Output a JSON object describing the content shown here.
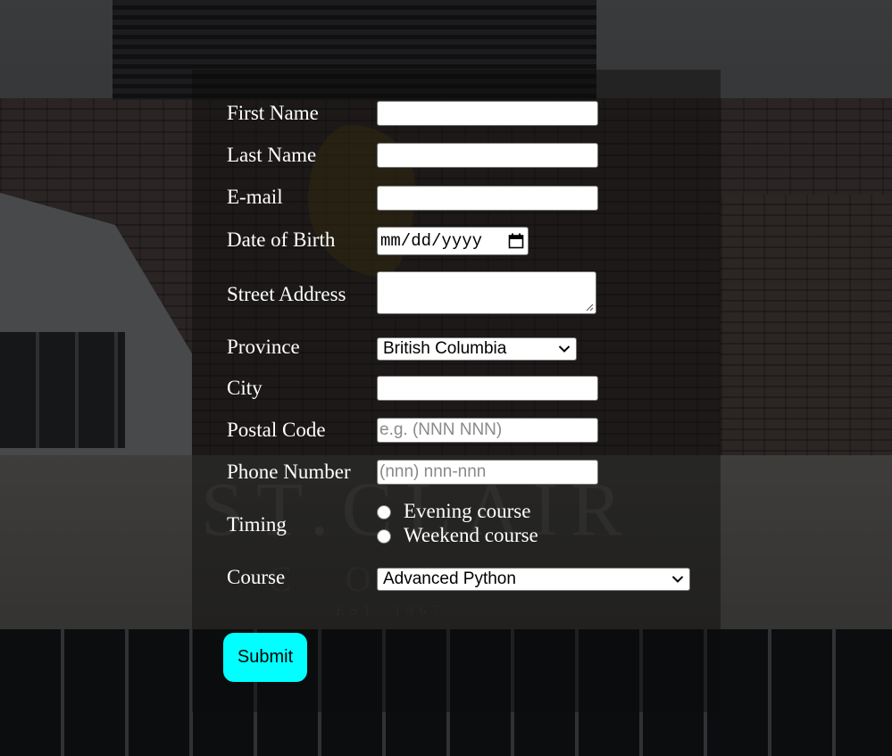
{
  "form": {
    "first_name": {
      "label": "First Name",
      "value": ""
    },
    "last_name": {
      "label": "Last Name",
      "value": ""
    },
    "email": {
      "label": "E-mail",
      "value": ""
    },
    "dob": {
      "label": "Date of Birth",
      "placeholder": "mm/dd/yyyy"
    },
    "street": {
      "label": "Street Address",
      "value": ""
    },
    "province": {
      "label": "Province",
      "selected": "British Columbia"
    },
    "city": {
      "label": "City",
      "value": ""
    },
    "postal": {
      "label": "Postal Code",
      "placeholder": "e.g. (NNN NNN)"
    },
    "phone": {
      "label": "Phone Number",
      "placeholder": "(nnn) nnn-nnn"
    },
    "timing": {
      "label": "Timing",
      "options": [
        "Evening course",
        "Weekend course"
      ]
    },
    "course": {
      "label": "Course",
      "selected": "Advanced Python"
    },
    "submit_label": "Submit"
  },
  "background_sign": {
    "line1": "ST.CLAIR",
    "line2": "COL",
    "line3": "EST. 1967"
  },
  "colors": {
    "submit_bg": "#00ffff",
    "label_text": "#ffffff"
  }
}
